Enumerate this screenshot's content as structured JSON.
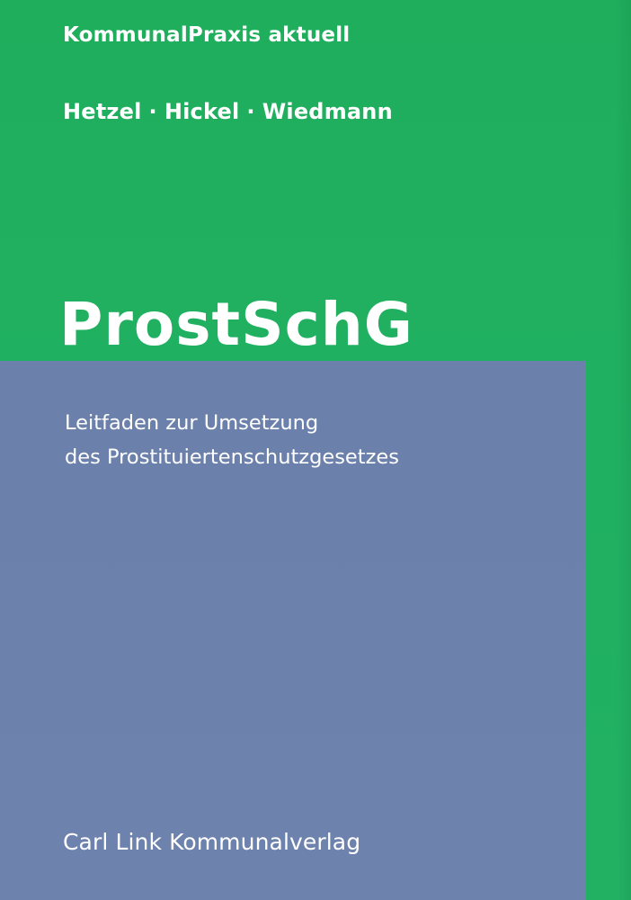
{
  "cover": {
    "series": "KommunalPraxis aktuell",
    "authors": [
      "Hetzel",
      "Hickel",
      "Wiedmann"
    ],
    "author_separator": "·",
    "title": "ProstSchG",
    "subtitle_lines": [
      "Leitfaden zur Umsetzung",
      "des Prostituiertenschutzgesetzes"
    ],
    "publisher": "Carl Link Kommunalverlag"
  },
  "colors": {
    "green_background": "#20b061",
    "blue_panel": "#6d81ad",
    "text": "#ffffff"
  }
}
